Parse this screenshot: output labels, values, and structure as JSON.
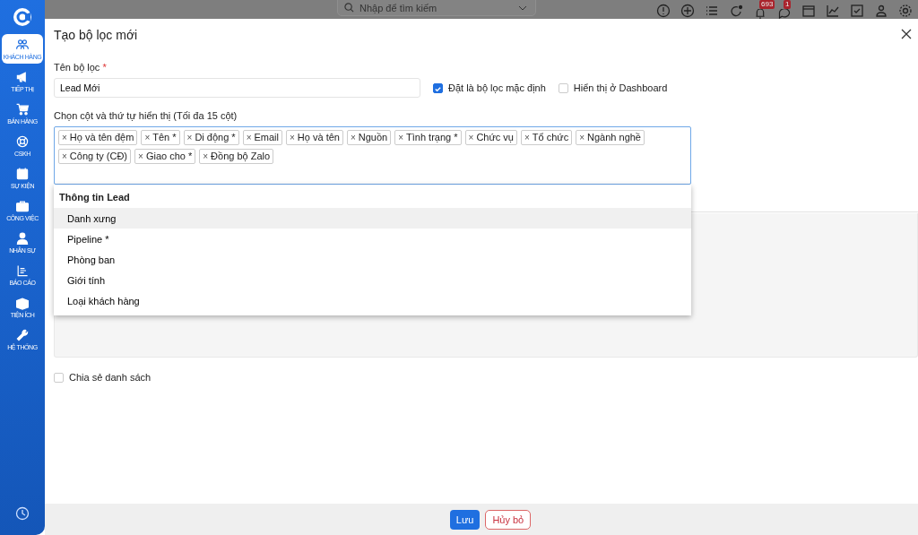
{
  "sidebar": {
    "items": [
      {
        "label": "KHÁCH HÀNG",
        "selected": true
      },
      {
        "label": "TIẾP THỊ",
        "selected": false
      },
      {
        "label": "BÁN HÀNG",
        "selected": false
      },
      {
        "label": "CSKH",
        "selected": false
      },
      {
        "label": "SỰ KIỆN",
        "selected": false
      },
      {
        "label": "CÔNG VIỆC",
        "selected": false
      },
      {
        "label": "NHÂN SỰ",
        "selected": false
      },
      {
        "label": "BÁO CÁO",
        "selected": false
      },
      {
        "label": "TIỆN ÍCH",
        "selected": false
      },
      {
        "label": "HỆ THỐNG",
        "selected": false
      }
    ]
  },
  "topbar": {
    "search": {
      "placeholder": "Nhập để tìm kiếm"
    },
    "notifications_badge": "693",
    "messages_badge": "1"
  },
  "dialog": {
    "title": "Tạo bộ lọc mới",
    "name_field": {
      "label": "Tên bộ lọc",
      "required_mark": "*",
      "value": "Lead Mới"
    },
    "default_checkbox": {
      "label": "Đặt là bộ lọc mặc định",
      "checked": true
    },
    "dashboard_checkbox": {
      "label": "Hiển thị ở Dashboard",
      "checked": false
    },
    "columns_label": "Chọn cột và thứ tự hiển thị (Tối đa 15 cột)",
    "remove_mark": "×",
    "selected_columns": [
      "Họ và tên đệm",
      "Tên *",
      "Di động *",
      "Email",
      "Họ và tên",
      "Nguồn",
      "Tình trạng *",
      "Chức vụ",
      "Tổ chức",
      "Ngành nghề",
      "Công ty (CĐ)",
      "Giao cho *",
      "Đồng bộ Zalo"
    ],
    "dropdown": {
      "group": "Thông tin Lead",
      "options": [
        {
          "label": "Danh xưng",
          "selected": true
        },
        {
          "label": "Pipeline *",
          "selected": false
        },
        {
          "label": "Phòng ban",
          "selected": false
        },
        {
          "label": "Giới tính",
          "selected": false
        },
        {
          "label": "Loại khách hàng",
          "selected": false
        }
      ]
    },
    "share_checkbox": {
      "label": "Chia sẻ danh sách",
      "checked": false
    },
    "buttons": {
      "save": "Lưu",
      "cancel": "Hủy bỏ"
    }
  }
}
